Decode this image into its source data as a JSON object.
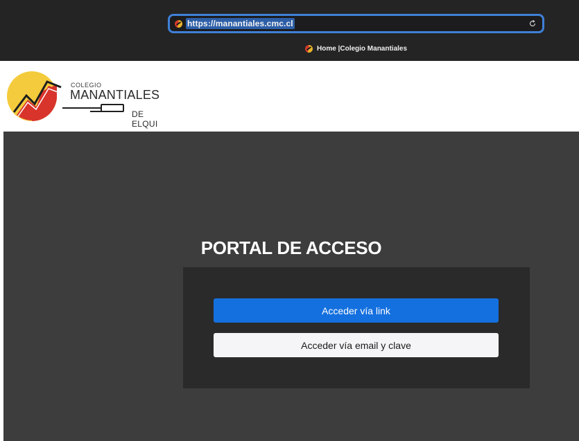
{
  "browser": {
    "url": "https://manantiales.cmc.cl",
    "tab_title": "Home |Colegio Manantiales"
  },
  "logo": {
    "small_text": "COLEGIO",
    "main_text": "MANANTIALES",
    "sub_text": "DE ELQUI"
  },
  "portal": {
    "title": "PORTAL DE ACCESO",
    "link_button_label": "Acceder vía link",
    "email_button_label": "Acceder vía email y clave"
  },
  "colors": {
    "chrome_bg": "#242424",
    "address_focus": "#3f80d6",
    "hero_bg": "#3d3d3d",
    "panel_bg": "#2a2a2a",
    "primary_button": "#1470df",
    "secondary_button": "#f5f5f7",
    "logo_yellow": "#f4cb3c",
    "logo_red": "#d8342c"
  },
  "icons": {
    "favicon": "school-logo-icon",
    "reload": "reload-icon"
  }
}
